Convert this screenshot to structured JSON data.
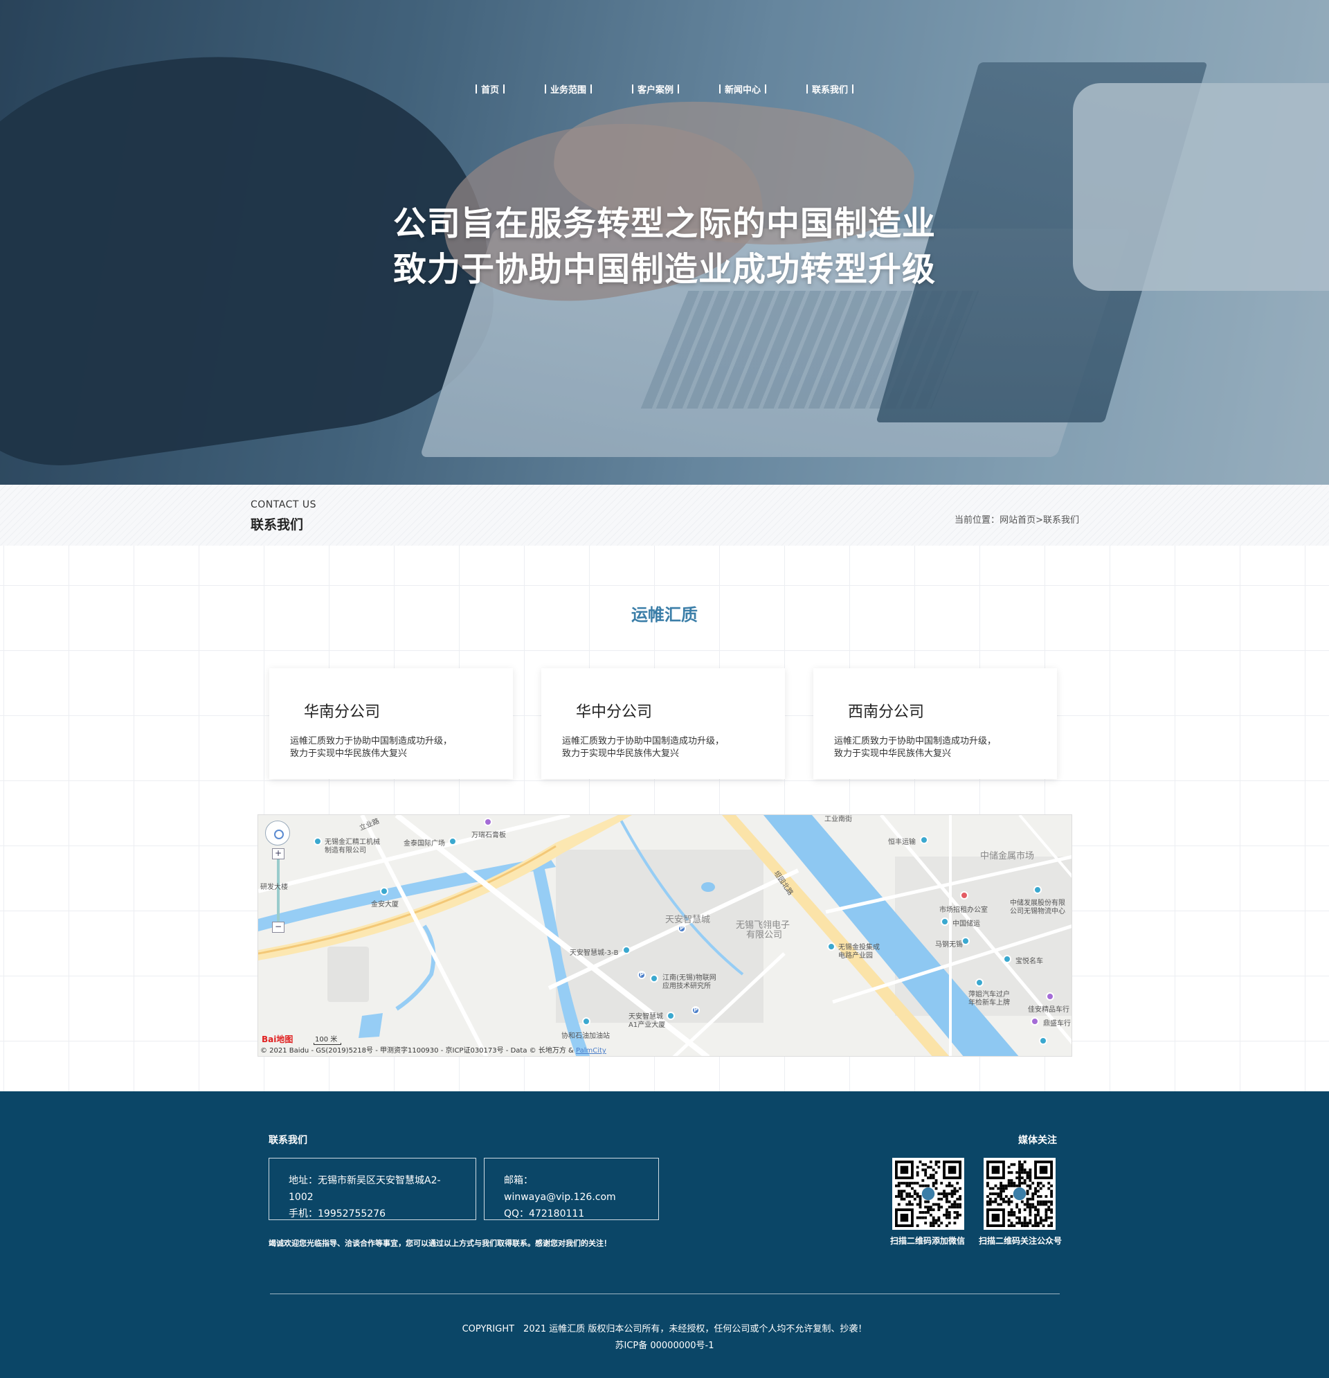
{
  "nav": {
    "items": [
      {
        "label": "首页"
      },
      {
        "label": "业务范围"
      },
      {
        "label": "客户案例"
      },
      {
        "label": "新闻中心"
      },
      {
        "label": "联系我们"
      }
    ]
  },
  "hero": {
    "line1": "公司旨在服务转型之际的中国制造业",
    "line2": "致力于协助中国制造业成功转型升级"
  },
  "crumb": {
    "en": "CONTACT US",
    "cn": "联系我们",
    "prefix": "当前位置：",
    "home": "网站首页",
    "sep": ">",
    "current": "联系我们"
  },
  "section": {
    "title": "运帷汇质"
  },
  "cards": [
    {
      "title": "华南分公司",
      "line1": "运帷汇质致力于协助中国制造成功升级，",
      "line2": "致力于实现中华民族伟大复兴"
    },
    {
      "title": "华中分公司",
      "line1": "运帷汇质致力于协助中国制造成功升级，",
      "line2": "致力于实现中华民族伟大复兴"
    },
    {
      "title": "西南分公司",
      "line1": "运帷汇质致力于协助中国制造成功升级，",
      "line2": "致力于实现中华民族伟大复兴"
    }
  ],
  "map": {
    "logo": "Bai地图",
    "scale": "100 米",
    "copyright": "© 2021 Baidu - GS(2019)5218号 - 甲测资字1100930 - 京ICP证030173号 - Data © 长地万方 &",
    "copyright_link": "PalmCity",
    "labels": {
      "l1": "立业路",
      "l2": "无锡金汇精工机械",
      "l3": "制造有限公司",
      "l4": "金泰国际广场",
      "l5": "万瑞石膏板",
      "l6": "研发大楼",
      "l7": "金安大厦",
      "l8": "天安智慧城",
      "l9": "无锡飞翎电子",
      "l10": "有限公司",
      "l11": "天安智慧城-3-B",
      "l12": "江南(无锡)物联网",
      "l13": "应用技术研究所",
      "l14": "天安智慧城",
      "l15": "A1产业大厦",
      "l16": "协和石油加油站",
      "l17": "恒丰运输",
      "l18": "中储金属市场",
      "l19": "市场招租办公室",
      "l20": "中储发展股份有限",
      "l21": "公司无锡物流中心",
      "l22": "中国储运",
      "l23": "马钢无锡",
      "l24": "无锡金投集成",
      "l25": "电路产业园",
      "l26": "宝悦名车",
      "l27": "萍姐汽车过户",
      "l28": "年检新车上牌",
      "l29": "佳安精品车行",
      "l30": "鼎盛车行",
      "l31": "工业南街",
      "l32": "坦园北路"
    }
  },
  "footer": {
    "contact_title": "联系我们",
    "media_title": "媒体关注",
    "address": "地址：无锡市新吴区天安智慧城A2-1002",
    "phone": "手机：19952755276",
    "email": "邮箱：winwaya@vip.126.com",
    "qq": "QQ：472180111",
    "note": "竭诚欢迎您光临指导、洽谈合作等事宜，您可以通过以上方式与我们取得联系。感谢您对我们的关注！",
    "qr1_caption": "扫描二维码添加微信",
    "qr2_caption": "扫描二维码关注公众号",
    "copyright": "COPYRIGHT　2021 运帷汇质 版权归本公司所有，未经授权，任何公司或个人均不允许复制、抄袭！",
    "icp": "苏ICP备 00000000号-1"
  },
  "colors": {
    "accent": "#3b7ea8",
    "footer_bg": "#0b4667"
  }
}
